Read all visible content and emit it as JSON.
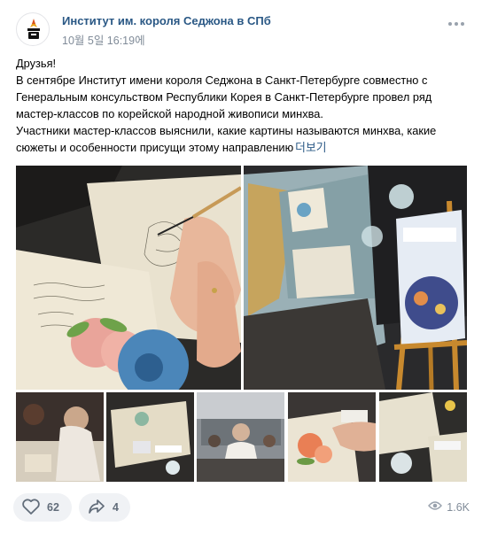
{
  "post": {
    "author": "Институт им. короля Седжона в СПб",
    "date": "10월 5일 16:19에",
    "text_lines": [
      "Друзья!",
      "В сентябре Институт имени короля Седжона в Санкт-Петербурге совместно с",
      "Генеральным консульством Республики Корея в Санкт-Петербурге провел ряд",
      "мастер-классов по корейской народной живописи минхва.",
      "Участники мастер-классов выяснили, какие картины называются минхва, какие",
      "сюжеты и особенности присущи этому направлению"
    ],
    "more_label": "더보기",
    "likes": "62",
    "shares": "4",
    "views": "1.6K"
  },
  "icons": {
    "avatar": "institute-logo-icon",
    "more": "more-dots-icon",
    "like": "heart-icon",
    "share": "share-arrow-icon",
    "views": "eye-icon"
  },
  "colors": {
    "link": "#2a5885",
    "muted": "#818c99",
    "button_bg": "#f0f2f5"
  }
}
